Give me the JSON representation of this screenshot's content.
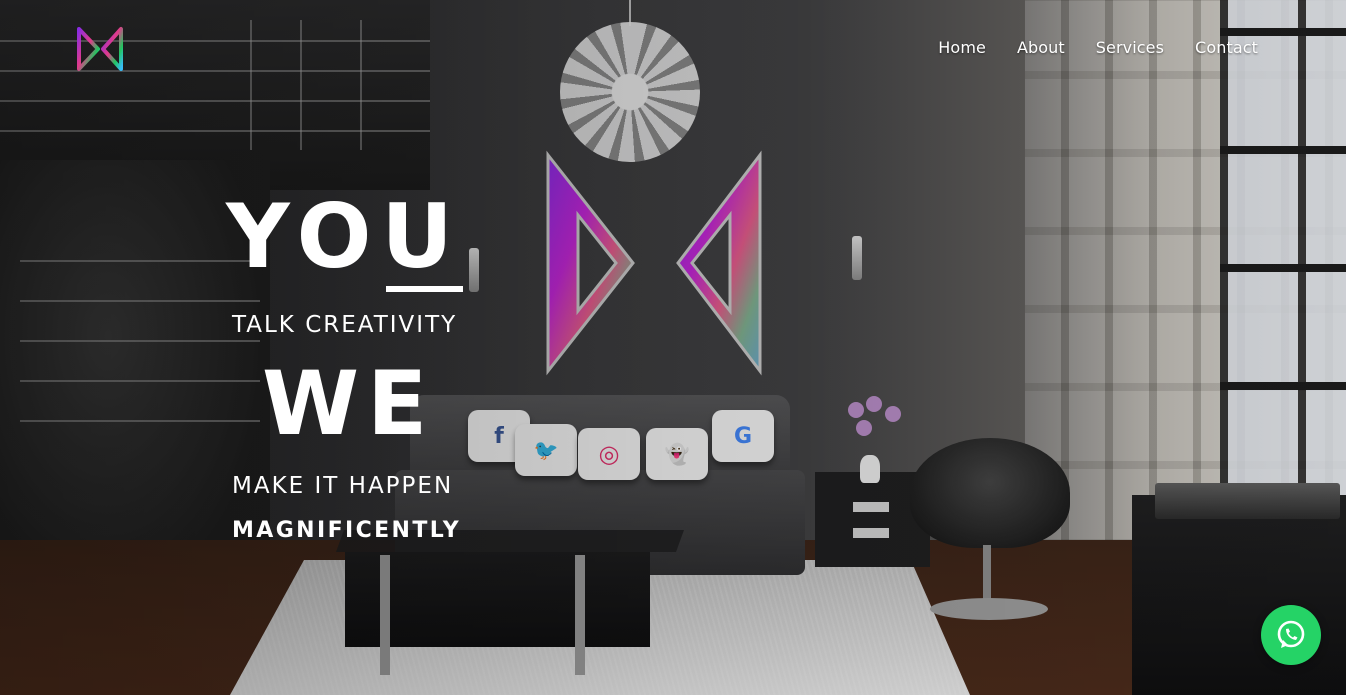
{
  "nav": {
    "items": [
      {
        "label": "Home"
      },
      {
        "label": "About"
      },
      {
        "label": "Services"
      },
      {
        "label": "Contact"
      }
    ]
  },
  "hero": {
    "line1": "YOU",
    "line2": "TALK CREATIVITY",
    "line3": "WE",
    "line4": "MAKE IT HAPPEN",
    "line5": "MAGNIFICENTLY"
  },
  "pillows": [
    {
      "icon": "facebook-icon",
      "glyph": "f",
      "color": "#3b5998"
    },
    {
      "icon": "twitter-icon",
      "glyph": "🐦",
      "color": "#1da1f2"
    },
    {
      "icon": "instagram-icon",
      "glyph": "◎",
      "color": "#e1306c"
    },
    {
      "icon": "snapchat-icon",
      "glyph": "👻",
      "color": "#f5d800"
    },
    {
      "icon": "google-icon",
      "glyph": "G",
      "color": "#4285f4"
    }
  ],
  "colors": {
    "whatsapp": "#25d366",
    "logo_gradient": [
      "#8a2be2",
      "#c026d3",
      "#ef4444",
      "#22c55e",
      "#38bdf8"
    ]
  },
  "icons": {
    "brand": "brand-logo-icon",
    "whatsapp": "whatsapp-icon"
  }
}
